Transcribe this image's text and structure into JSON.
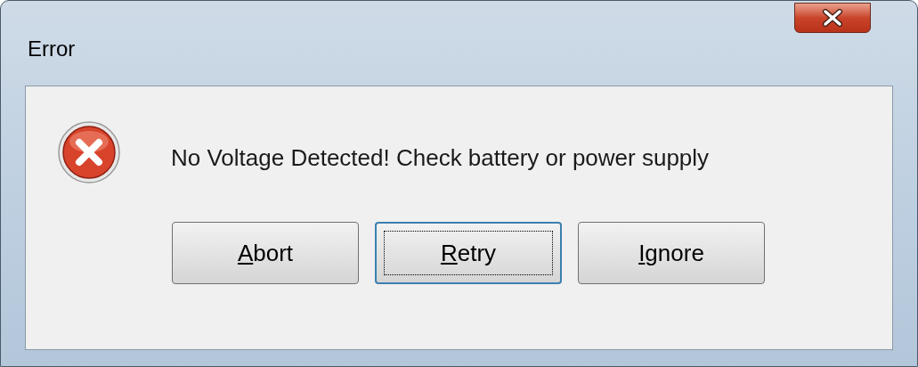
{
  "window": {
    "title": "Error"
  },
  "message": "No Voltage Detected! Check battery or power supply",
  "buttons": [
    {
      "label": "Abort",
      "focused": false
    },
    {
      "label": "Retry",
      "focused": true
    },
    {
      "label": "Ignore",
      "focused": false
    }
  ]
}
